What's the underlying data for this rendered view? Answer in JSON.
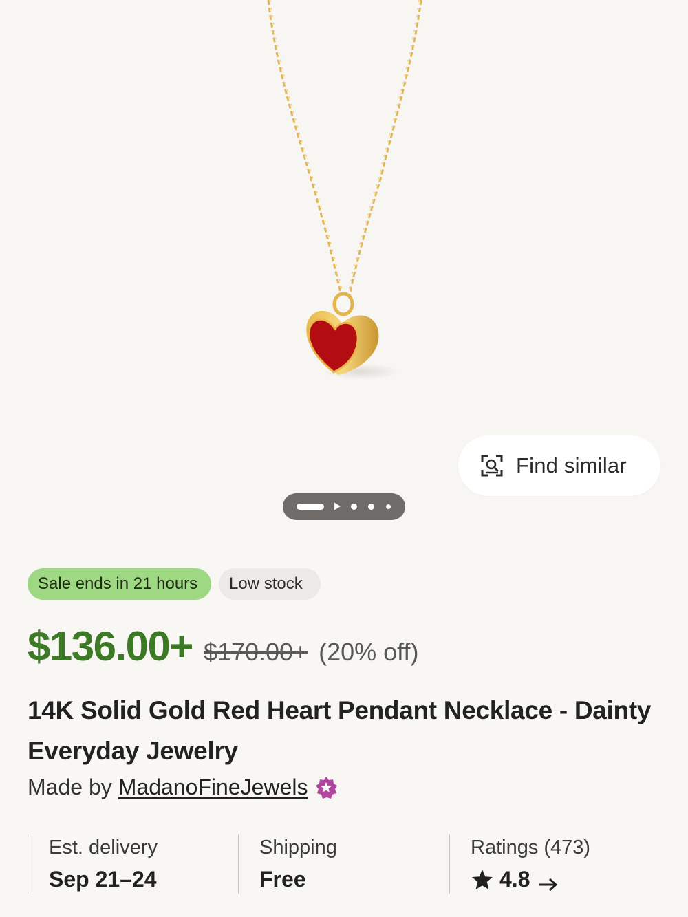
{
  "hero": {
    "image_alt": "Red heart pendant on gold chain",
    "find_similar_label": "Find similar",
    "find_similar_icon": "image-search-icon",
    "pager": {
      "current": 1,
      "total": 5,
      "has_video": true
    }
  },
  "badges": {
    "sale": "Sale ends in 21 hours",
    "stock": "Low stock"
  },
  "price": {
    "current": "$136.00+",
    "original": "$170.00+",
    "discount": "(20% off)"
  },
  "product": {
    "title": "14K Solid Gold Red Heart Pendant Necklace - Dainty Everyday Jewelry",
    "made_by_prefix": "Made by",
    "shop_name": "MadanoFineJewels",
    "star_seller_icon": "star-seller-badge-icon"
  },
  "info": {
    "delivery_label": "Est. delivery",
    "delivery_value": "Sep 21–24",
    "shipping_label": "Shipping",
    "shipping_value": "Free",
    "ratings_label": "Ratings (473)",
    "ratings_value": "4.8"
  },
  "colors": {
    "price_green": "#3c7a25",
    "sale_badge": "#9fd883",
    "star_seller": "#b0479f"
  }
}
